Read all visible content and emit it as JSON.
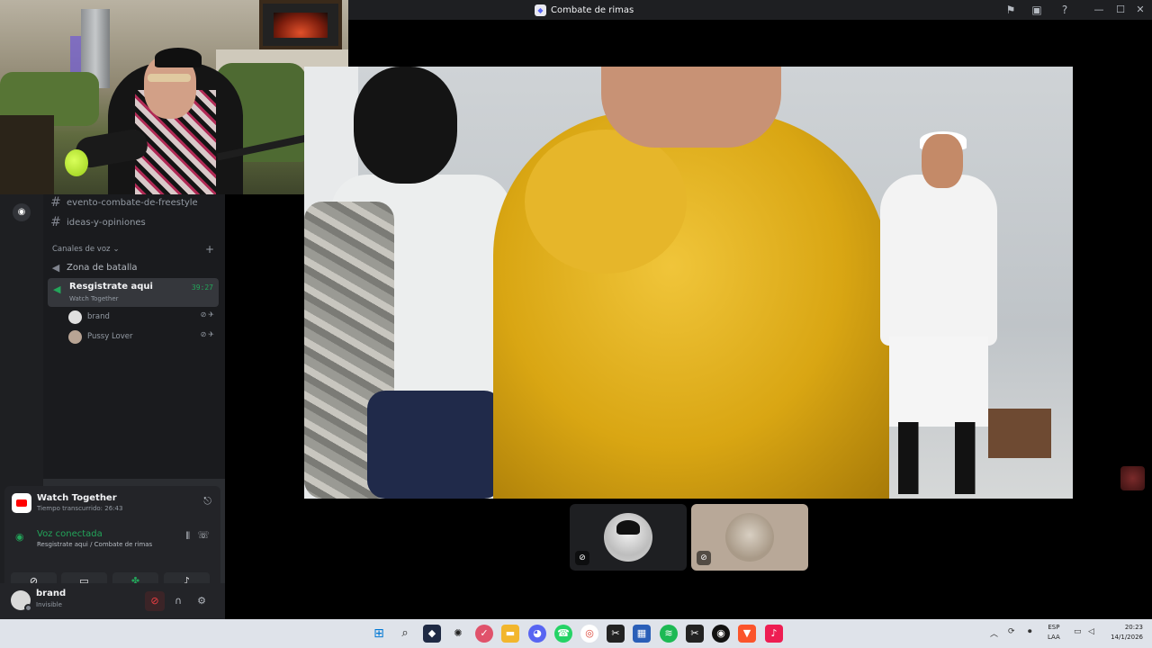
{
  "window": {
    "title": "Combate de rimas",
    "title_icon": "discord-stage-icon",
    "controls": [
      "minimize-icon",
      "maximize-icon",
      "close-icon"
    ],
    "toolbar_icons": [
      "flag-icon",
      "inbox-icon",
      "help-icon"
    ]
  },
  "channels": {
    "text": [
      {
        "name": "evento-combate-de-freestyle"
      },
      {
        "name": "ideas-y-opiniones"
      }
    ],
    "voice_category": "Canales de voz",
    "voice": [
      {
        "name": "Zona de batalla"
      }
    ],
    "active_voice": {
      "name": "Resgistrate aqui",
      "activity": "Watch Together",
      "timer": "39:27"
    },
    "members": [
      {
        "name": "brand"
      },
      {
        "name": "Pussy Lover"
      }
    ]
  },
  "activity": {
    "title": "Watch Together",
    "elapsed": "Tiempo transcurrido: 26:43"
  },
  "voice": {
    "status": "Voz conectada",
    "location": "Resgistrate aqui / Combate de rimas"
  },
  "user": {
    "name": "brand",
    "status": "Invisible"
  },
  "taskbar": {
    "lang_top": "ESP",
    "lang_bottom": "LAA",
    "time": "20:23",
    "date": "14/1/2026"
  },
  "colors": {
    "accent_green": "#23a55a",
    "sidebar": "#2b2d31",
    "danger": "#f23f43",
    "blurple": "#5865f2"
  }
}
